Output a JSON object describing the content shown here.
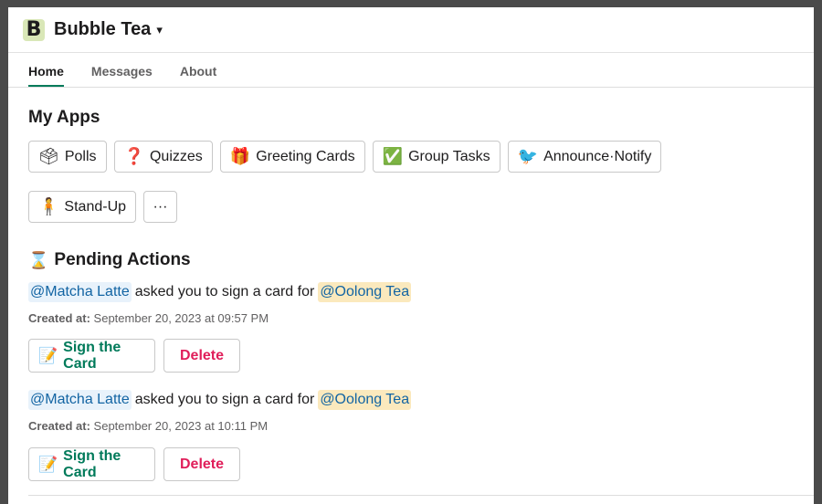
{
  "workspace": {
    "logo_letter": "B",
    "name": "Bubble Tea",
    "chevron": "⌄"
  },
  "tabs": [
    {
      "label": "Home",
      "active": true
    },
    {
      "label": "Messages",
      "active": false
    },
    {
      "label": "About",
      "active": false
    }
  ],
  "apps": {
    "title": "My Apps",
    "items": [
      {
        "icon": "🗳",
        "icon_name": "ballot-box-icon",
        "label": "Polls"
      },
      {
        "icon": "❓",
        "icon_name": "question-mark-icon",
        "label": "Quizzes"
      },
      {
        "icon": "🎁",
        "icon_name": "gift-icon",
        "label": "Greeting Cards"
      },
      {
        "icon": "✅",
        "icon_name": "check-mark-icon",
        "label": "Group Tasks"
      },
      {
        "icon": "🐦",
        "icon_name": "bird-icon",
        "label": "Announce·Notify"
      },
      {
        "icon": "🧍",
        "icon_name": "standing-person-icon",
        "label": "Stand-Up"
      }
    ],
    "more_label": "···"
  },
  "pending": {
    "icon": "⌛",
    "title": "Pending Actions",
    "items": [
      {
        "requester": "@Matcha Latte",
        "text": "asked you to sign a card for",
        "recipient": "@Oolong Tea",
        "created_label": "Created at:",
        "created_value": "September 20, 2023 at 09:57 PM",
        "sign_icon": "📝",
        "sign_label": "Sign the Card",
        "delete_label": "Delete"
      },
      {
        "requester": "@Matcha Latte",
        "text": "asked you to sign a card for",
        "recipient": "@Oolong Tea",
        "created_label": "Created at:",
        "created_value": "September 20, 2023 at 10:11 PM",
        "sign_icon": "📝",
        "sign_label": "Sign the Card",
        "delete_label": "Delete"
      }
    ]
  },
  "colors": {
    "accent": "#007a5a",
    "danger": "#e01e5a",
    "link": "#1264a3"
  }
}
